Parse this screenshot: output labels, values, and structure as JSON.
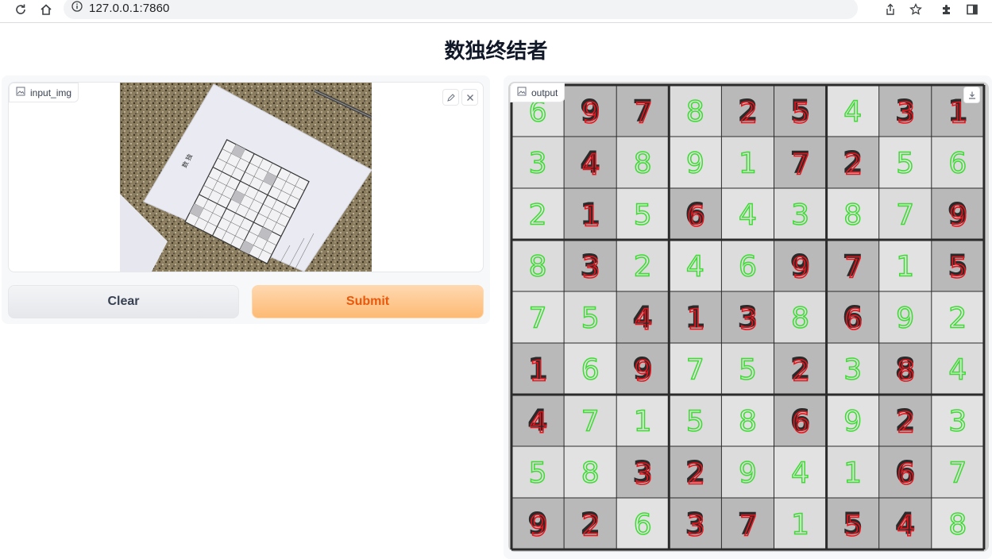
{
  "browser": {
    "url": "127.0.0.1:7860",
    "icons": [
      "reload-icon",
      "home-icon",
      "info-icon",
      "share-icon",
      "bookmark-star-icon",
      "extensions-icon",
      "side-panel-icon"
    ]
  },
  "page": {
    "title": "数独终结者"
  },
  "input": {
    "label": "input_img",
    "icons": [
      "image-icon",
      "edit-pencil-icon",
      "close-icon"
    ],
    "photo_heading": "数 独",
    "clear_label": "Clear",
    "submit_label": "Submit"
  },
  "output": {
    "label": "output",
    "icons": [
      "image-icon",
      "download-icon"
    ],
    "grid": [
      [
        6,
        9,
        7,
        8,
        2,
        5,
        4,
        3,
        1
      ],
      [
        3,
        4,
        8,
        9,
        1,
        7,
        2,
        5,
        6
      ],
      [
        2,
        1,
        5,
        6,
        4,
        3,
        8,
        7,
        9
      ],
      [
        8,
        3,
        2,
        4,
        6,
        9,
        7,
        1,
        5
      ],
      [
        7,
        5,
        4,
        1,
        3,
        8,
        6,
        9,
        2
      ],
      [
        1,
        6,
        9,
        7,
        5,
        2,
        3,
        8,
        4
      ],
      [
        4,
        7,
        1,
        5,
        8,
        6,
        9,
        2,
        3
      ],
      [
        5,
        8,
        3,
        2,
        9,
        4,
        1,
        6,
        7
      ],
      [
        9,
        2,
        6,
        3,
        7,
        1,
        5,
        4,
        8
      ]
    ],
    "given": [
      [
        0,
        1,
        1,
        0,
        1,
        1,
        0,
        1,
        1
      ],
      [
        0,
        1,
        0,
        0,
        0,
        1,
        1,
        0,
        0
      ],
      [
        0,
        1,
        0,
        1,
        0,
        0,
        0,
        0,
        1
      ],
      [
        0,
        1,
        0,
        0,
        0,
        1,
        1,
        0,
        1
      ],
      [
        0,
        0,
        1,
        1,
        1,
        0,
        1,
        0,
        0
      ],
      [
        1,
        0,
        1,
        0,
        0,
        1,
        0,
        1,
        0
      ],
      [
        1,
        0,
        0,
        0,
        0,
        1,
        0,
        1,
        0
      ],
      [
        0,
        0,
        1,
        1,
        0,
        0,
        0,
        1,
        0
      ],
      [
        1,
        1,
        0,
        1,
        1,
        0,
        1,
        1,
        0
      ]
    ],
    "colors": {
      "given": "#e8141c",
      "solved": "#3ddc32",
      "grid": "#2b2b2b"
    }
  }
}
